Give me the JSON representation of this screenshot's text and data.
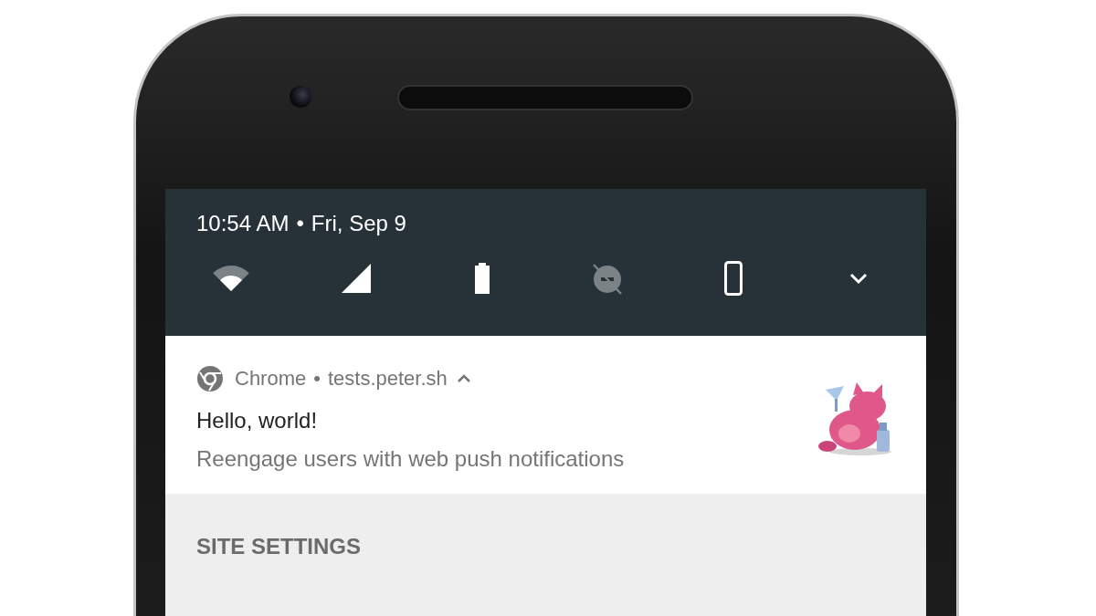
{
  "status_panel": {
    "time": "10:54 AM",
    "separator": "•",
    "date": "Fri, Sep 9",
    "tiles": [
      {
        "kind": "wifi",
        "on": true
      },
      {
        "kind": "cellular",
        "on": true
      },
      {
        "kind": "battery",
        "on": true
      },
      {
        "kind": "do_not_disturb",
        "on": false
      },
      {
        "kind": "rotation",
        "on": true
      }
    ],
    "expand": {
      "expanded": false
    }
  },
  "notification": {
    "app": "Chrome",
    "separator": "•",
    "origin": "tests.peter.sh",
    "expanded": true,
    "title": "Hello, world!",
    "body": "Reengage users with web push notifications"
  },
  "actions": [
    {
      "label": "SITE SETTINGS"
    }
  ]
}
